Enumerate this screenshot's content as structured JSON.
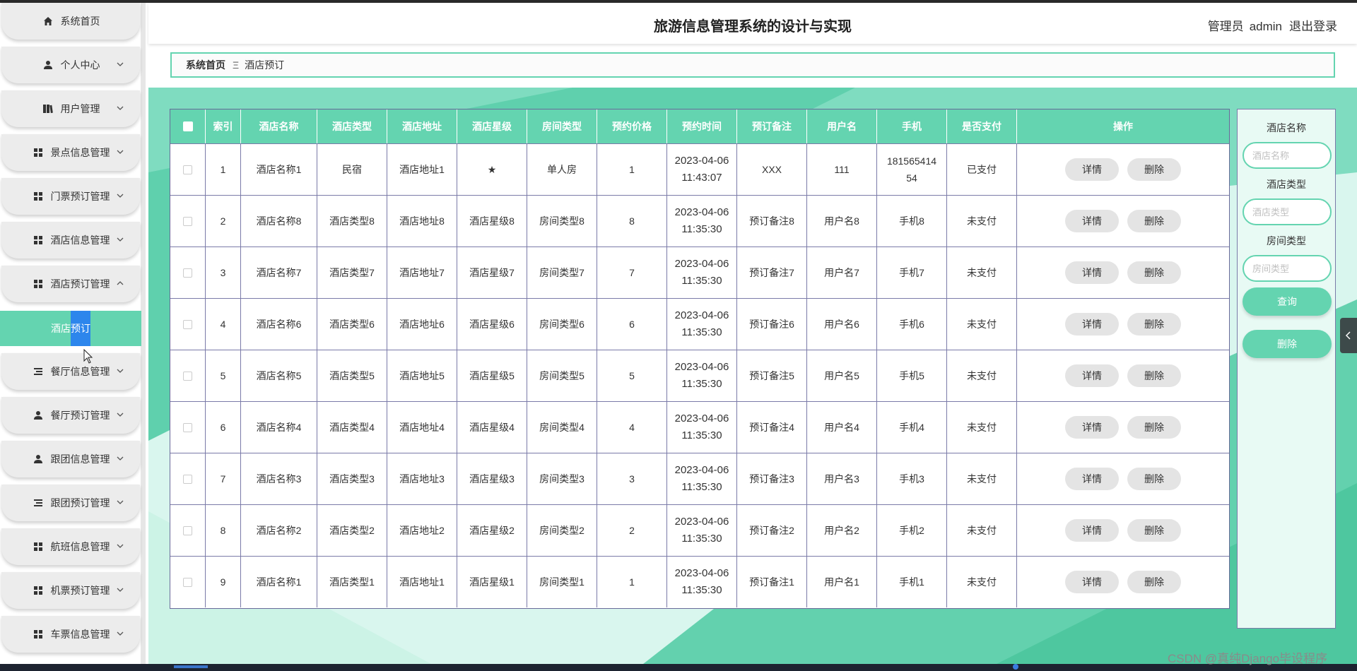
{
  "colors": {
    "accent": "#64d4b0",
    "selected": "#2d86ec",
    "text": "#333333"
  },
  "header": {
    "title": "旅游信息管理系统的设计与实现",
    "role": "管理员",
    "username": "admin",
    "logout": "退出登录"
  },
  "breadcrumb": {
    "home": "系统首页",
    "separator": "Ξ",
    "current": "酒店预订"
  },
  "sidebar": {
    "items": [
      {
        "label": "系统首页",
        "icon": "home-icon"
      },
      {
        "label": "个人中心",
        "icon": "user-icon"
      },
      {
        "label": "用户管理",
        "icon": "book-icon"
      },
      {
        "label": "景点信息管理",
        "icon": "grid-icon"
      },
      {
        "label": "门票预订管理",
        "icon": "grid-icon"
      },
      {
        "label": "酒店信息管理",
        "icon": "grid-icon"
      },
      {
        "label": "酒店预订管理",
        "icon": "grid-icon"
      },
      {
        "label": "餐厅信息管理",
        "icon": "list-icon"
      },
      {
        "label": "餐厅预订管理",
        "icon": "user-icon"
      },
      {
        "label": "跟团信息管理",
        "icon": "user-icon"
      },
      {
        "label": "跟团预订管理",
        "icon": "list-icon"
      },
      {
        "label": "航班信息管理",
        "icon": "grid-icon"
      },
      {
        "label": "机票预订管理",
        "icon": "grid-icon"
      },
      {
        "label": "车票信息管理",
        "icon": "grid-icon"
      }
    ],
    "submenu": {
      "label_prefix": "酒店",
      "label_selected": "预订"
    }
  },
  "table": {
    "columns": [
      "索引",
      "酒店名称",
      "酒店类型",
      "酒店地址",
      "酒店星级",
      "房间类型",
      "预约价格",
      "预约时间",
      "预订备注",
      "用户名",
      "手机",
      "是否支付",
      "操作"
    ],
    "detail_label": "详情",
    "delete_label": "删除",
    "rows": [
      {
        "index": "1",
        "name": "酒店名称1",
        "type": "民宿",
        "address": "酒店地址1",
        "star": "★",
        "room": "单人房",
        "price": "1",
        "date": "2023-04-06",
        "time": "11:43:07",
        "note": "XXX",
        "user": "111",
        "phone1": "181565414",
        "phone2": "54",
        "paid": "已支付"
      },
      {
        "index": "2",
        "name": "酒店名称8",
        "type": "酒店类型8",
        "address": "酒店地址8",
        "star": "酒店星级8",
        "room": "房间类型8",
        "price": "8",
        "date": "2023-04-06",
        "time": "11:35:30",
        "note": "预订备注8",
        "user": "用户名8",
        "phone1": "手机8",
        "phone2": "",
        "paid": "未支付"
      },
      {
        "index": "3",
        "name": "酒店名称7",
        "type": "酒店类型7",
        "address": "酒店地址7",
        "star": "酒店星级7",
        "room": "房间类型7",
        "price": "7",
        "date": "2023-04-06",
        "time": "11:35:30",
        "note": "预订备注7",
        "user": "用户名7",
        "phone1": "手机7",
        "phone2": "",
        "paid": "未支付"
      },
      {
        "index": "4",
        "name": "酒店名称6",
        "type": "酒店类型6",
        "address": "酒店地址6",
        "star": "酒店星级6",
        "room": "房间类型6",
        "price": "6",
        "date": "2023-04-06",
        "time": "11:35:30",
        "note": "预订备注6",
        "user": "用户名6",
        "phone1": "手机6",
        "phone2": "",
        "paid": "未支付"
      },
      {
        "index": "5",
        "name": "酒店名称5",
        "type": "酒店类型5",
        "address": "酒店地址5",
        "star": "酒店星级5",
        "room": "房间类型5",
        "price": "5",
        "date": "2023-04-06",
        "time": "11:35:30",
        "note": "预订备注5",
        "user": "用户名5",
        "phone1": "手机5",
        "phone2": "",
        "paid": "未支付"
      },
      {
        "index": "6",
        "name": "酒店名称4",
        "type": "酒店类型4",
        "address": "酒店地址4",
        "star": "酒店星级4",
        "room": "房间类型4",
        "price": "4",
        "date": "2023-04-06",
        "time": "11:35:30",
        "note": "预订备注4",
        "user": "用户名4",
        "phone1": "手机4",
        "phone2": "",
        "paid": "未支付"
      },
      {
        "index": "7",
        "name": "酒店名称3",
        "type": "酒店类型3",
        "address": "酒店地址3",
        "star": "酒店星级3",
        "room": "房间类型3",
        "price": "3",
        "date": "2023-04-06",
        "time": "11:35:30",
        "note": "预订备注3",
        "user": "用户名3",
        "phone1": "手机3",
        "phone2": "",
        "paid": "未支付"
      },
      {
        "index": "8",
        "name": "酒店名称2",
        "type": "酒店类型2",
        "address": "酒店地址2",
        "star": "酒店星级2",
        "room": "房间类型2",
        "price": "2",
        "date": "2023-04-06",
        "time": "11:35:30",
        "note": "预订备注2",
        "user": "用户名2",
        "phone1": "手机2",
        "phone2": "",
        "paid": "未支付"
      },
      {
        "index": "9",
        "name": "酒店名称1",
        "type": "酒店类型1",
        "address": "酒店地址1",
        "star": "酒店星级1",
        "room": "房间类型1",
        "price": "1",
        "date": "2023-04-06",
        "time": "11:35:30",
        "note": "预订备注1",
        "user": "用户名1",
        "phone1": "手机1",
        "phone2": "",
        "paid": "未支付"
      }
    ]
  },
  "search": {
    "hotel_name_label": "酒店名称",
    "hotel_name_placeholder": "酒店名称",
    "hotel_type_label": "酒店类型",
    "hotel_type_placeholder": "酒店类型",
    "room_type_label": "房间类型",
    "room_type_placeholder": "房间类型",
    "query_label": "查询",
    "delete_label": "删除"
  },
  "watermark": "CSDN @真纯Django毕设程序"
}
